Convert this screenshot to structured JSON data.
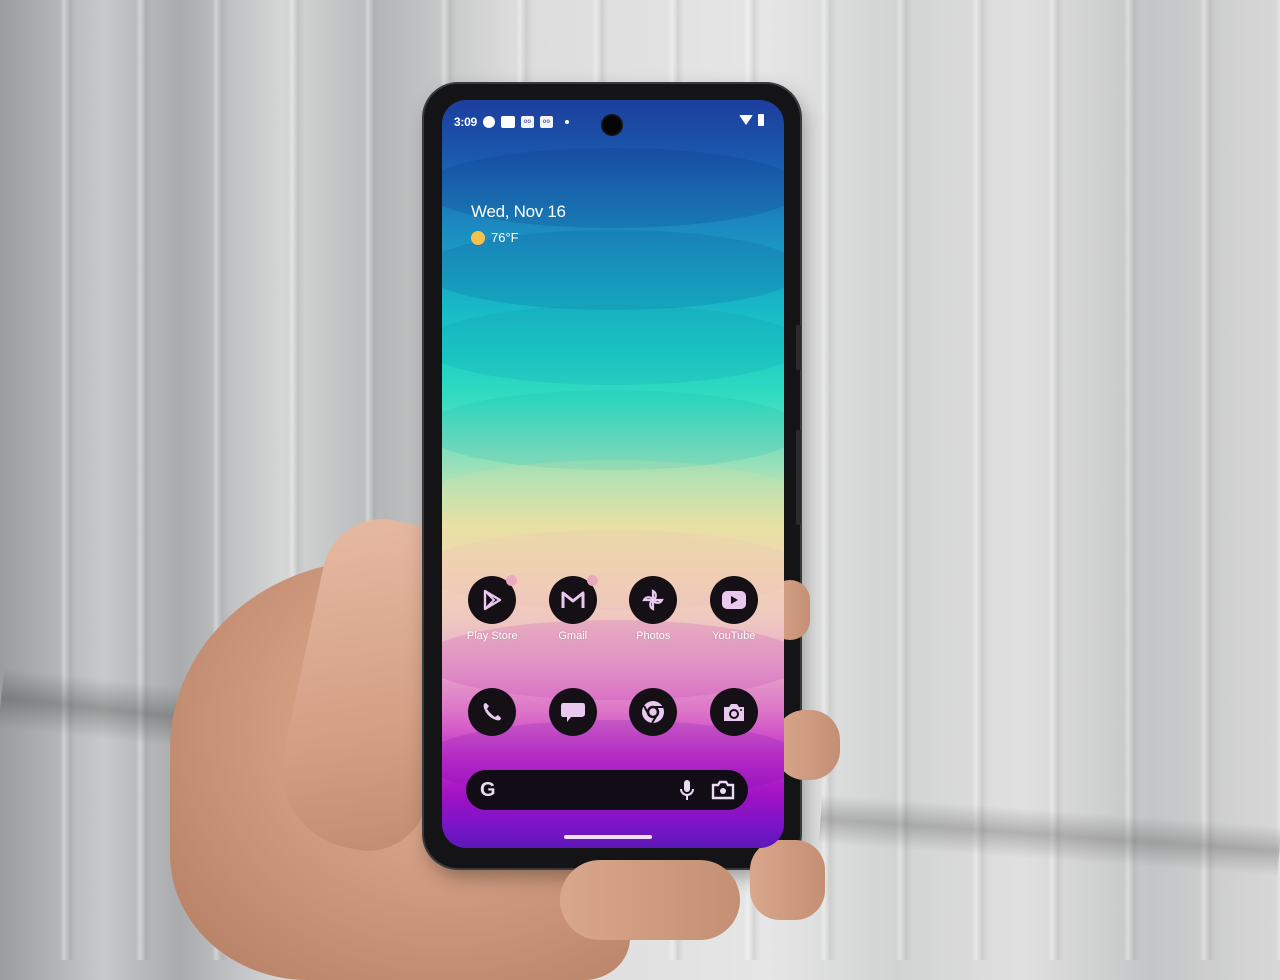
{
  "scene": {
    "description": "Hand holding an Android phone showing a home screen with a wavy gradient wallpaper"
  },
  "status_bar": {
    "time": "3:09",
    "notification_icons": [
      "messenger-icon",
      "teams-icon",
      "voicemail-icon",
      "voicemail-icon",
      "more-notifications-dot"
    ],
    "voicemail_glyph": "oo",
    "right_icons": [
      "wifi-icon",
      "battery-icon"
    ]
  },
  "widget": {
    "date": "Wed, Nov 16",
    "weather_icon": "sun-icon",
    "temperature": "76°F"
  },
  "apps_row1": [
    {
      "label": "Play Store",
      "icon": "play-store-icon",
      "badge": true
    },
    {
      "label": "Gmail",
      "icon": "gmail-icon",
      "badge": true
    },
    {
      "label": "Photos",
      "icon": "photos-icon",
      "badge": false
    },
    {
      "label": "YouTube",
      "icon": "youtube-icon",
      "badge": false
    }
  ],
  "dock": [
    {
      "name": "Phone",
      "icon": "phone-icon"
    },
    {
      "name": "Messages",
      "icon": "messages-icon"
    },
    {
      "name": "Chrome",
      "icon": "chrome-icon"
    },
    {
      "name": "Camera",
      "icon": "camera-icon"
    }
  ],
  "search_bar": {
    "logo": "G",
    "right_icons": [
      "mic-icon",
      "lens-icon"
    ]
  },
  "colors": {
    "icon_background": "#151015",
    "icon_glyph": "#e9c9f0",
    "badge": "#e9a9bf",
    "sun": "#f8c24a"
  }
}
